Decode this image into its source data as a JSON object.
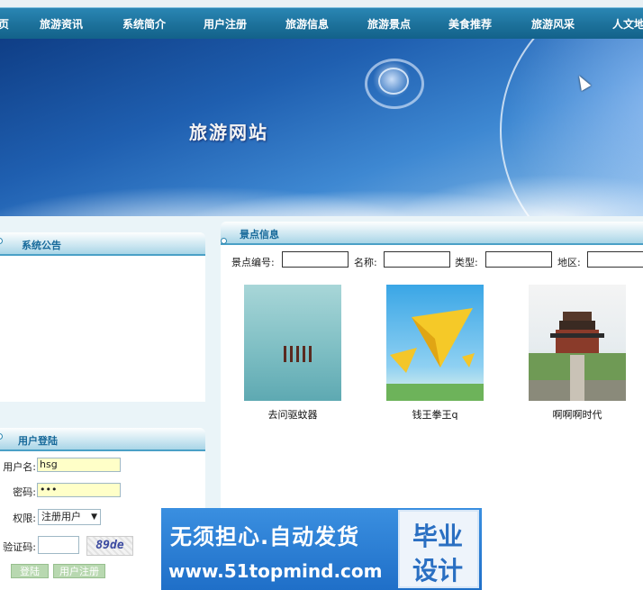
{
  "nav": {
    "items": [
      "页",
      "旅游资讯",
      "系统简介",
      "用户注册",
      "旅游信息",
      "旅游景点",
      "美食推荐",
      "旅游风采",
      "人文地"
    ]
  },
  "banner": {
    "title": "旅游网站"
  },
  "announcement": {
    "title": "系统公告"
  },
  "login": {
    "title": "用户登陆",
    "username_label": "用户名:",
    "username_value": "hsg",
    "password_label": "密码:",
    "password_value": "•••",
    "role_label": "权限:",
    "role_value": "注册用户",
    "role_arrow": "▼",
    "captcha_label": "验证码:",
    "captcha_text": "89de",
    "login_button": "登陆",
    "register_button": "用户注册"
  },
  "spots": {
    "title": "景点信息",
    "search_labels": {
      "id": "景点编号:",
      "name": "名称:",
      "type": "类型:",
      "region": "地区:"
    },
    "items": [
      {
        "name": "去问驱蚊器",
        "image": "sea-rocks-photo"
      },
      {
        "name": "钱王拳王q",
        "image": "paper-plane-poster"
      },
      {
        "name": "啊啊啊时代",
        "image": "drum-tower-photo"
      }
    ]
  },
  "ad": {
    "line1": "无须担心.自动发货",
    "line2": "www.51topmind.com",
    "box_line1": "毕业",
    "box_line2": "设计"
  },
  "colors": {
    "nav": "#1b6f98",
    "accent": "#17699a",
    "input_bg": "#ffffc8",
    "ad_bg": "#1f6fc8"
  }
}
